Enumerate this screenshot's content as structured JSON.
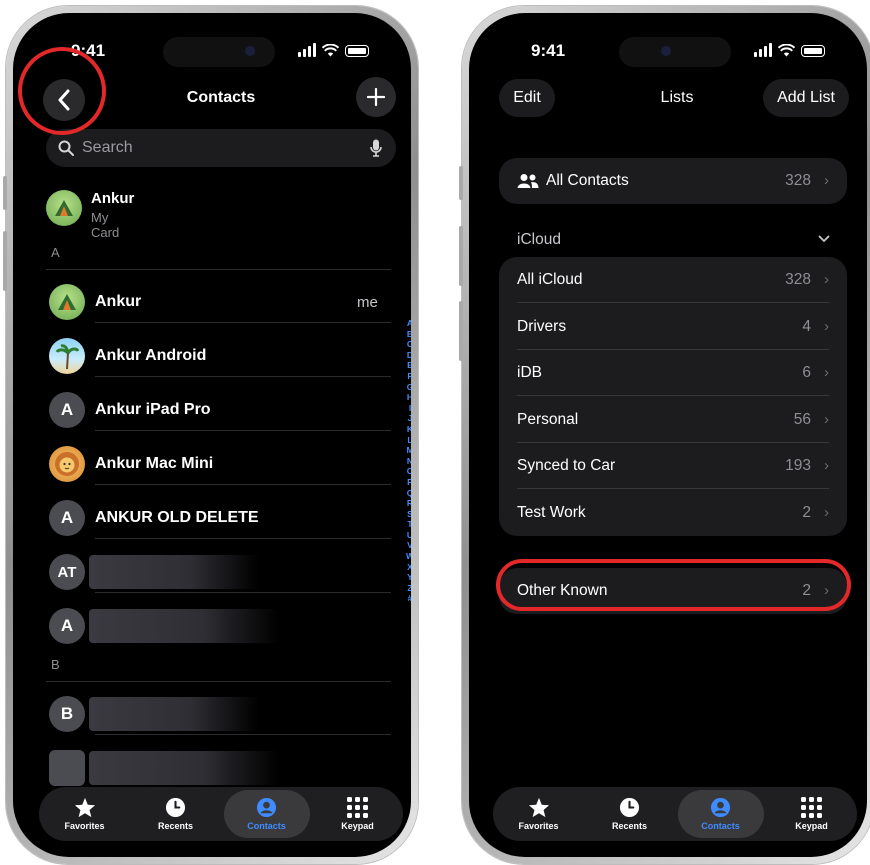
{
  "left_phone": {
    "status_time": "9:41",
    "nav": {
      "back_icon": "chevron-left-icon",
      "title": "Contacts",
      "add_icon": "plus-icon"
    },
    "search": {
      "placeholder": "Search",
      "search_icon": "search-icon",
      "mic_icon": "mic-icon"
    },
    "my_card": {
      "name": "Ankur",
      "subtitle": "My Card"
    },
    "section_a": "A",
    "contacts": [
      {
        "name": "Ankur",
        "tag": "me",
        "avatar": "campfire-photo"
      },
      {
        "name": "Ankur Android",
        "avatar": "palm-photo"
      },
      {
        "name": "Ankur iPad Pro",
        "initials": "A"
      },
      {
        "name": "Ankur Mac Mini",
        "avatar": "lion-photo"
      },
      {
        "name": "ANKUR OLD DELETE",
        "initials": "A"
      },
      {
        "initials": "AT"
      },
      {
        "initials": "A"
      }
    ],
    "section_b": "B",
    "contacts_b": [
      {
        "initials": "B"
      },
      {
        "initials": ""
      }
    ],
    "index_letters": [
      "A",
      "B",
      "C",
      "D",
      "E",
      "F",
      "G",
      "H",
      "I",
      "J",
      "K",
      "L",
      "M",
      "N",
      "O",
      "P",
      "Q",
      "R",
      "S",
      "T",
      "U",
      "V",
      "W",
      "X",
      "Y",
      "Z",
      "#"
    ],
    "tabs": [
      {
        "label": "Favorites",
        "icon": "star-icon"
      },
      {
        "label": "Recents",
        "icon": "clock-icon"
      },
      {
        "label": "Contacts",
        "icon": "person-icon",
        "active": true
      },
      {
        "label": "Keypad",
        "icon": "keypad-icon"
      }
    ]
  },
  "right_phone": {
    "status_time": "9:41",
    "nav": {
      "edit": "Edit",
      "title": "Lists",
      "add_list": "Add List"
    },
    "all_contacts": {
      "label": "All Contacts",
      "count": "328",
      "icon": "people-icon"
    },
    "icloud_header": "iCloud",
    "icloud_lists": [
      {
        "label": "All iCloud",
        "count": "328"
      },
      {
        "label": "Drivers",
        "count": "4"
      },
      {
        "label": "iDB",
        "count": "6"
      },
      {
        "label": "Personal",
        "count": "56"
      },
      {
        "label": "Synced to Car",
        "count": "193"
      },
      {
        "label": "Test Work",
        "count": "2"
      }
    ],
    "other_known": {
      "label": "Other Known",
      "count": "2"
    },
    "tabs": [
      {
        "label": "Favorites",
        "icon": "star-icon"
      },
      {
        "label": "Recents",
        "icon": "clock-icon"
      },
      {
        "label": "Contacts",
        "icon": "person-icon",
        "active": true
      },
      {
        "label": "Keypad",
        "icon": "keypad-icon"
      }
    ]
  },
  "colors": {
    "highlight": "#e3282a",
    "accent": "#3e8cff",
    "background": "#000000"
  }
}
